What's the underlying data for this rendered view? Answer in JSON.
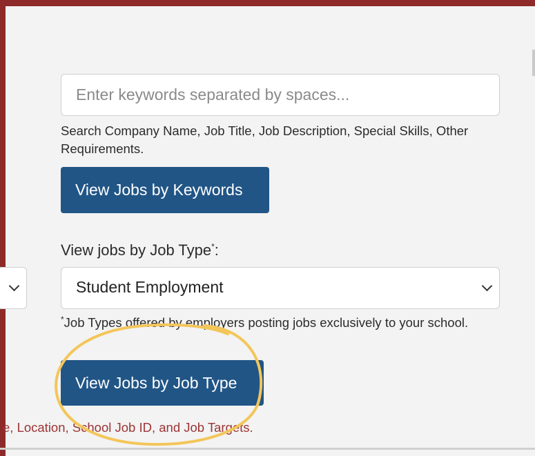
{
  "search": {
    "placeholder": "Enter keywords separated by spaces...",
    "help_text": "Search Company Name, Job Title, Job Description, Special Skills, Other Requirements.",
    "button_label": "View Jobs by Keywords"
  },
  "job_type": {
    "label": "View jobs by Job Type",
    "label_marker": "*",
    "label_suffix": ":",
    "selected": "Student Employment",
    "note_marker": "*",
    "note": "Job Types offered by employers posting jobs exclusively to your school.",
    "button_label": "View Jobs by Job Type"
  },
  "truncated_note": "e, Location, School Job ID, and Job Targets.",
  "colors": {
    "button_bg": "#215586",
    "frame": "#8f2a2a",
    "panel": "#f3f3f3",
    "highlight_circle": "#f3c65a",
    "red_text": "#9c3434"
  },
  "icons": {
    "select_arrow": "chevron-down-icon"
  }
}
